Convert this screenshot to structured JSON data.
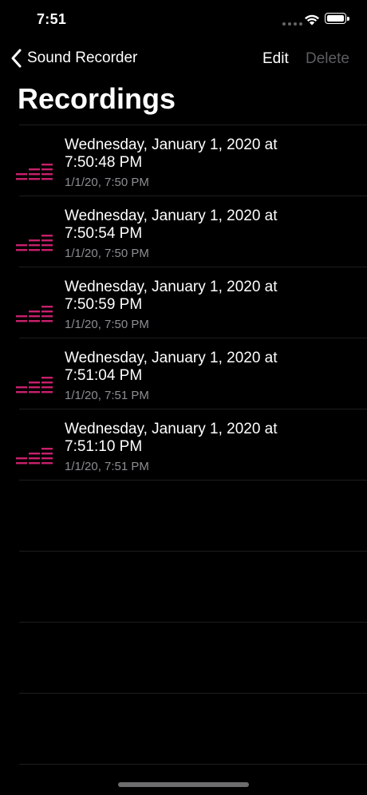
{
  "status": {
    "time": "7:51"
  },
  "nav": {
    "back_label": "Sound Recorder",
    "edit_label": "Edit",
    "delete_label": "Delete"
  },
  "title": "Recordings",
  "accent_color": "#c8206c",
  "recordings": [
    {
      "title_line1": "Wednesday, January 1, 2020 at",
      "title_line2": "7:50:48 PM",
      "subtitle": "1/1/20, 7:50 PM"
    },
    {
      "title_line1": "Wednesday, January 1, 2020 at",
      "title_line2": "7:50:54 PM",
      "subtitle": "1/1/20, 7:50 PM"
    },
    {
      "title_line1": "Wednesday, January 1, 2020 at",
      "title_line2": "7:50:59 PM",
      "subtitle": "1/1/20, 7:50 PM"
    },
    {
      "title_line1": "Wednesday, January 1, 2020 at",
      "title_line2": "7:51:04 PM",
      "subtitle": "1/1/20, 7:51 PM"
    },
    {
      "title_line1": "Wednesday, January 1, 2020 at",
      "title_line2": "7:51:10 PM",
      "subtitle": "1/1/20, 7:51 PM"
    }
  ],
  "icons": {
    "row": "audio-level-icon",
    "back": "chevron-left-icon"
  }
}
